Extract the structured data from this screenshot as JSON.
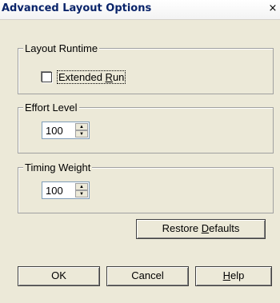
{
  "window": {
    "title": "Advanced Layout Options",
    "close_symbol": "×"
  },
  "layout_runtime": {
    "group_label": "Layout Runtime",
    "extended_run_label": "Extended Run",
    "extended_run_checked": false
  },
  "effort_level": {
    "group_label": "Effort Level",
    "value": "100"
  },
  "timing_weight": {
    "group_label": "Timing Weight",
    "value": "100"
  },
  "buttons": {
    "restore_defaults": "Restore Defaults",
    "ok": "OK",
    "cancel": "Cancel",
    "help": "Help"
  },
  "colors": {
    "title_text": "#0a246a",
    "dialog_bg": "#ece9d8"
  }
}
